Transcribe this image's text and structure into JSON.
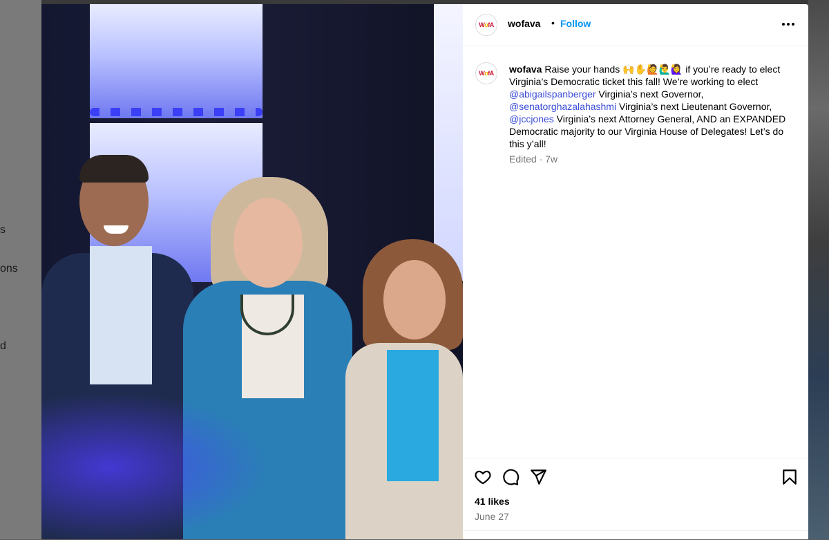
{
  "background": {
    "left_fragments": [
      "s",
      "ons",
      "d"
    ]
  },
  "post": {
    "author": {
      "username": "wofava",
      "avatar_text_left": "W",
      "avatar_text_mid": "o",
      "avatar_text_right": "fA"
    },
    "header": {
      "separator": "•",
      "follow_label": "Follow",
      "more_icon": "more-horizontal-icon"
    },
    "caption": {
      "username": "wofava",
      "part1": " Raise your hands 🙌✋🙋🙋‍♂️🙋‍♀️ if you’re ready to elect Virginia’s Democratic ticket this fall! We’re working to elect ",
      "mention1": "@abigailspanberger",
      "part2": " Virginia’s next Governor, ",
      "mention2": "@senatorghazalahashmi",
      "part3": " Virginia’s next Lieutenant Governor, ",
      "mention3": "@jccjones",
      "part4": " Virginia’s next Attorney General, AND an EXPANDED Democratic majority to our Virginia House of Delegates! Let’s do this y’all!"
    },
    "edited_label": "Edited · 7w",
    "actions": {
      "like_icon": "heart-icon",
      "comment_icon": "comment-icon",
      "share_icon": "share-icon",
      "save_icon": "bookmark-icon"
    },
    "likes": "41 likes",
    "date": "June 27"
  }
}
